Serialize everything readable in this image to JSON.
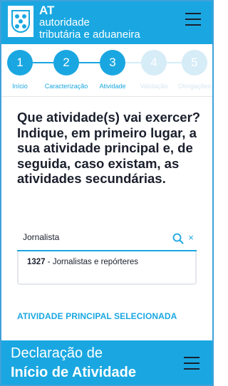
{
  "header": {
    "brand_short": "AT",
    "brand_line1": "autoridade",
    "brand_line2": "tributária e aduaneira",
    "menu_icon": "hamburger-icon"
  },
  "stepper": {
    "steps": [
      {
        "number": "1",
        "label": "Início",
        "active": true
      },
      {
        "number": "2",
        "label": "Caracterização",
        "active": true
      },
      {
        "number": "3",
        "label": "Atividade",
        "active": true
      },
      {
        "number": "4",
        "label": "Validação",
        "active": false
      },
      {
        "number": "5",
        "label": "Obrigações",
        "active": false
      }
    ]
  },
  "main": {
    "question": "Que atividade(s) vai exercer? Indique, em primeiro lugar, a sua atividade principal e, de seguida, caso existam, as atividades secundárias.",
    "search": {
      "value": "Jornalista",
      "placeholder": ""
    },
    "suggestion": {
      "code": "1327",
      "text": " - Jornalistas e repórteres"
    },
    "section_title": "ATIVIDADE PRINCIPAL SELECIONADA"
  },
  "banner": {
    "line1": "Declaração de",
    "line2": "Início de Atividade"
  },
  "colors": {
    "accent": "#1aa7e1",
    "inactive_step": "#d6ecf7",
    "text": "#1a1f2c"
  }
}
